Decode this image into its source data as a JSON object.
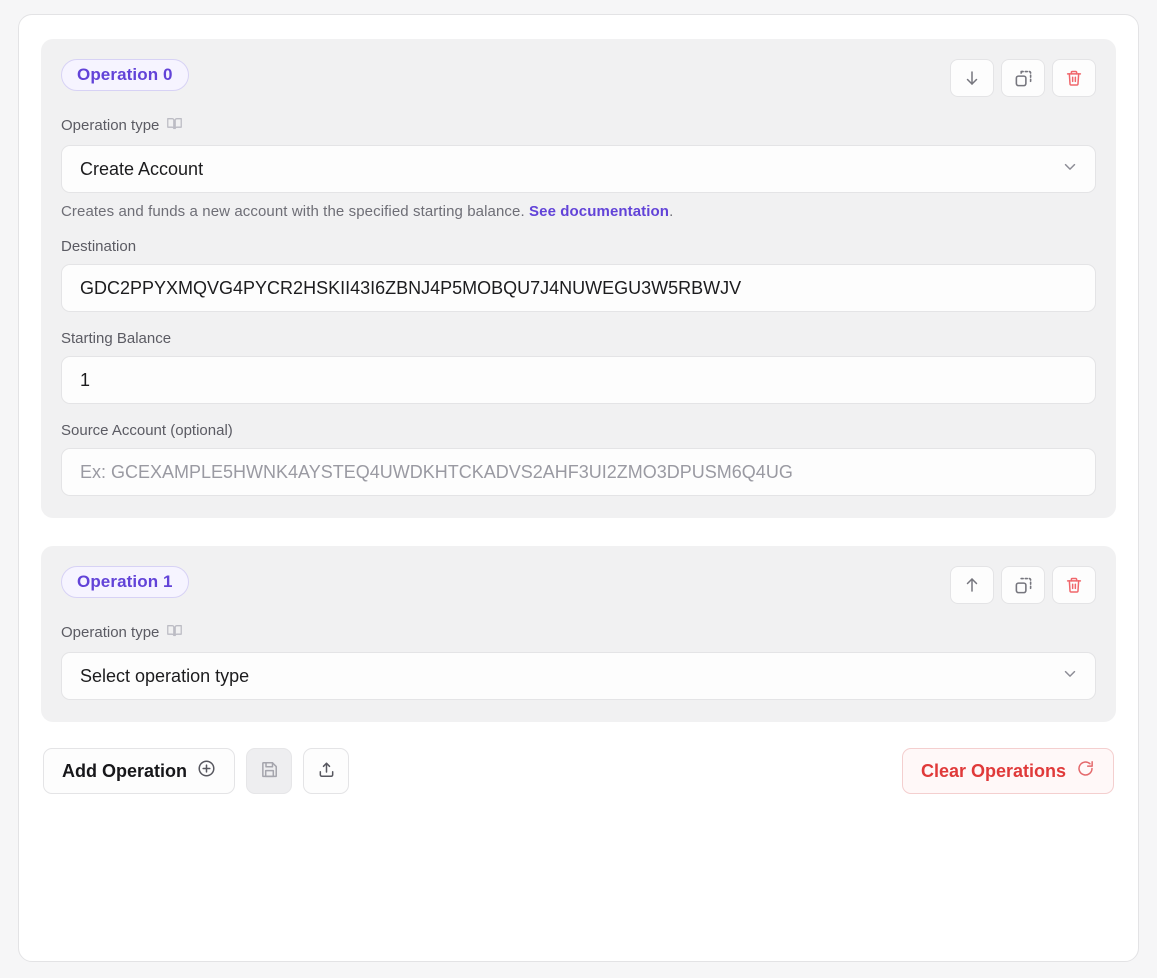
{
  "theme": {
    "accent_purple": "#6243d8",
    "badge_bg": "#f6f4ff",
    "badge_border": "#d7d2f5",
    "danger_red": "#e03a3a",
    "card_bg": "#f1f1f2",
    "page_bg": "#f6f6f7",
    "surface": "#ffffff"
  },
  "operations": [
    {
      "badge_label": "Operation 0",
      "actions": {
        "move_label": "Move operation down",
        "move_icon": "arrow-down-icon",
        "duplicate_label": "Duplicate operation",
        "duplicate_icon": "duplicate-icon",
        "delete_label": "Delete operation",
        "delete_icon": "trash-icon"
      },
      "operation_type": {
        "label": "Operation type",
        "doc_icon": "book-icon",
        "value": "Create Account",
        "chevron_icon": "chevron-down-icon"
      },
      "help": {
        "text_before": "Creates and funds a new account with the specified starting balance. ",
        "link_text": "See documentation",
        "text_after": "."
      },
      "fields": [
        {
          "label": "Destination",
          "value": "GDC2PPYXMQVG4PYCR2HSKII43I6ZBNJ4P5MOBQU7J4NUWEGU3W5RBWJV",
          "placeholder": "",
          "is_placeholder": false
        },
        {
          "label": "Starting Balance",
          "value": "1",
          "placeholder": "",
          "is_placeholder": false
        },
        {
          "label": "Source Account (optional)",
          "value": "",
          "placeholder": "Ex: GCEXAMPLE5HWNK4AYSTEQ4UWDKHTCKADVS2AHF3UI2ZMO3DPUSM6Q4UG",
          "is_placeholder": true
        }
      ]
    },
    {
      "badge_label": "Operation 1",
      "actions": {
        "move_label": "Move operation up",
        "move_icon": "arrow-up-icon",
        "duplicate_label": "Duplicate operation",
        "duplicate_icon": "duplicate-icon",
        "delete_label": "Delete operation",
        "delete_icon": "trash-icon"
      },
      "operation_type": {
        "label": "Operation type",
        "doc_icon": "book-icon",
        "value": "Select operation type",
        "chevron_icon": "chevron-down-icon",
        "is_placeholder": true
      },
      "fields": []
    }
  ],
  "action_bar": {
    "add_operation_label": "Add Operation",
    "add_operation_icon": "plus-circle-icon",
    "save_icon": "save-icon",
    "save_label": "Save",
    "upload_icon": "upload-icon",
    "upload_label": "Share",
    "clear_operations_label": "Clear Operations",
    "clear_operations_icon": "reset-icon"
  }
}
